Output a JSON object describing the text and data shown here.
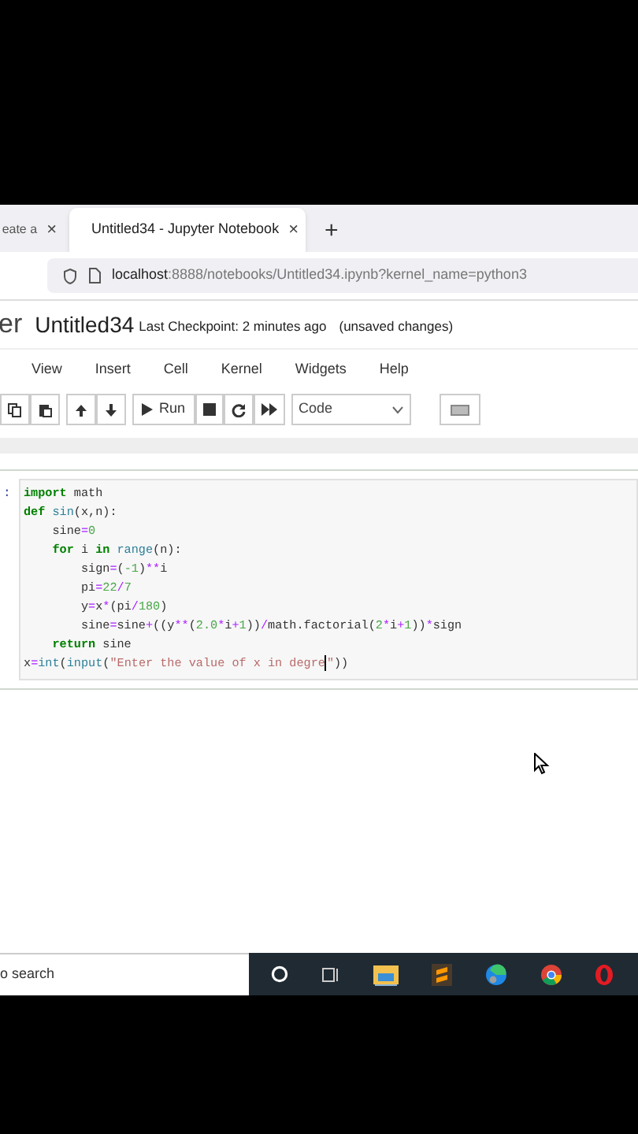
{
  "browser": {
    "tabs": [
      {
        "title": "eate a",
        "selected": false,
        "close": "×"
      },
      {
        "title": "Untitled34 - Jupyter Notebook",
        "selected": true,
        "close": "×"
      }
    ],
    "new_tab": "+",
    "address": {
      "host": "localhost",
      "path": ":8888/notebooks/Untitled34.ipynb?kernel_name=python3"
    }
  },
  "notebook": {
    "logo_text": "er",
    "title": "Untitled34",
    "checkpoint": "Last Checkpoint: 2 minutes ago",
    "status": "(unsaved changes)",
    "menu": [
      "View",
      "Insert",
      "Cell",
      "Kernel",
      "Widgets",
      "Help"
    ],
    "toolbar": {
      "run_label": "Run",
      "cell_type": "Code"
    },
    "cell": {
      "prompt": ":",
      "lines": [
        [
          {
            "t": "import",
            "kind": "kw"
          },
          {
            "t": " math"
          }
        ],
        [
          {
            "t": "def ",
            "kind": "kw"
          },
          {
            "t": "sin",
            "kind": "fn"
          },
          {
            "t": "(x,n):"
          }
        ],
        [
          {
            "t": "    sine"
          },
          {
            "t": "=",
            "kind": "op"
          },
          {
            "t": "0",
            "kind": "num"
          }
        ],
        [
          {
            "t": "    for",
            "kind": "kw"
          },
          {
            "t": " i "
          },
          {
            "t": "in ",
            "kind": "kw"
          },
          {
            "t": "range",
            "kind": "fn"
          },
          {
            "t": "(n):"
          }
        ],
        [
          {
            "t": "        sign"
          },
          {
            "t": "=",
            "kind": "op"
          },
          {
            "t": "("
          },
          {
            "t": "-1",
            "kind": "num"
          },
          {
            "t": ")"
          },
          {
            "t": "**",
            "kind": "op"
          },
          {
            "t": "i"
          }
        ],
        [
          {
            "t": "        pi"
          },
          {
            "t": "=",
            "kind": "op"
          },
          {
            "t": "22",
            "kind": "num"
          },
          {
            "t": "/",
            "kind": "op"
          },
          {
            "t": "7",
            "kind": "num"
          }
        ],
        [
          {
            "t": "        y"
          },
          {
            "t": "=",
            "kind": "op"
          },
          {
            "t": "x"
          },
          {
            "t": "*",
            "kind": "op"
          },
          {
            "t": "(pi"
          },
          {
            "t": "/",
            "kind": "op"
          },
          {
            "t": "180",
            "kind": "num"
          },
          {
            "t": ")"
          }
        ],
        [
          {
            "t": "        sine"
          },
          {
            "t": "=",
            "kind": "op"
          },
          {
            "t": "sine"
          },
          {
            "t": "+",
            "kind": "op"
          },
          {
            "t": "((y"
          },
          {
            "t": "**",
            "kind": "op"
          },
          {
            "t": "("
          },
          {
            "t": "2.0",
            "kind": "num"
          },
          {
            "t": "*",
            "kind": "op"
          },
          {
            "t": "i"
          },
          {
            "t": "+",
            "kind": "op"
          },
          {
            "t": "1",
            "kind": "num"
          },
          {
            "t": "))"
          },
          {
            "t": "/",
            "kind": "op"
          },
          {
            "t": "math.factorial("
          },
          {
            "t": "2",
            "kind": "num"
          },
          {
            "t": "*",
            "kind": "op"
          },
          {
            "t": "i"
          },
          {
            "t": "+",
            "kind": "op"
          },
          {
            "t": "1",
            "kind": "num"
          },
          {
            "t": "))"
          },
          {
            "t": "*",
            "kind": "op"
          },
          {
            "t": "sign"
          }
        ],
        [
          {
            "t": "    return",
            "kind": "kw"
          },
          {
            "t": " sine"
          }
        ],
        [
          {
            "t": "x"
          },
          {
            "t": "=",
            "kind": "op"
          },
          {
            "t": "int",
            "kind": "fn"
          },
          {
            "t": "("
          },
          {
            "t": "input",
            "kind": "fn"
          },
          {
            "t": "("
          },
          {
            "t": "\"Enter the value of x in degre",
            "kind": "str",
            "cursor_after": true
          },
          {
            "t": "\"",
            "kind": "str"
          },
          {
            "t": "))"
          }
        ]
      ]
    }
  },
  "taskbar": {
    "search_placeholder": "o search"
  }
}
